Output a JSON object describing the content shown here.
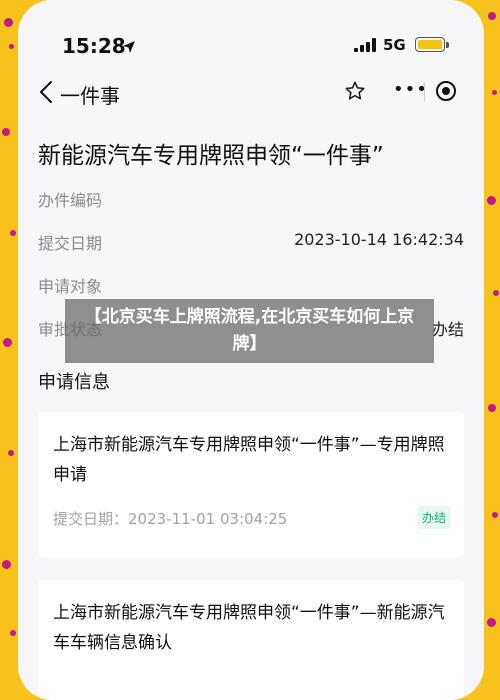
{
  "status_bar": {
    "time": "15:28",
    "network": "5G"
  },
  "header": {
    "title": "一件事"
  },
  "page": {
    "title": "新能源汽车专用牌照申领“一件事”",
    "fields": [
      {
        "label": "办件编码",
        "value": ""
      },
      {
        "label": "提交日期",
        "value": "2023-10-14 16:42:34"
      },
      {
        "label": "申请对象",
        "value": ""
      },
      {
        "label": "审批状态",
        "value": "办结"
      }
    ],
    "section_title": "申请信息"
  },
  "cards": [
    {
      "title": "上海市新能源汽车专用牌照申领“一件事”—专用牌照申请",
      "date": "提交日期：2023-11-01 03:04:25",
      "badge": "办结"
    },
    {
      "title": "上海市新能源汽车专用牌照申领“一件事”—新能源汽车车辆信息确认"
    }
  ],
  "overlay": {
    "text": "【北京买车上牌照流程,在北京买车如何上京牌】"
  },
  "colors": {
    "background": "#f6c21b",
    "dots": "#c2188c",
    "badge_green": "#22a97a"
  },
  "icons": [
    "navigation-arrow-icon",
    "signal-icon",
    "battery-icon",
    "back-chevron-icon",
    "star-icon",
    "more-icon",
    "target-icon"
  ]
}
